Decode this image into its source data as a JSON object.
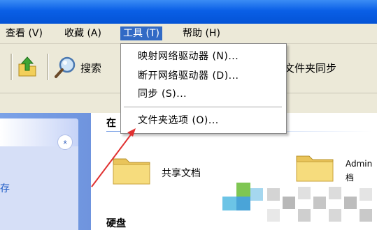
{
  "menubar": {
    "items": [
      {
        "label": "查看 (V)"
      },
      {
        "label": "收藏 (A)"
      },
      {
        "label": "工具 (T)"
      },
      {
        "label": "帮助 (H)"
      }
    ]
  },
  "toolbar": {
    "search_label": "搜索",
    "folders_label": "文件夹同步"
  },
  "dropdown": {
    "items": [
      {
        "label": "映射网络驱动器 (N)..."
      },
      {
        "label": "断开网络驱动器 (D)..."
      },
      {
        "label": "同步 (S)..."
      },
      {
        "label": "文件夹选项 (O)..."
      }
    ]
  },
  "taskpane": {
    "collapse_glyph": "«",
    "partial_text": "存"
  },
  "content": {
    "header": "在",
    "folders": [
      {
        "label": "共享文档"
      },
      {
        "label_line1": "Admin",
        "label_line2": "档"
      }
    ],
    "section_label": "硬盘"
  },
  "colors": {
    "accent": "#316ac5",
    "annotation_arrow": "#e03030",
    "folder_yellow": "#f3d774"
  }
}
